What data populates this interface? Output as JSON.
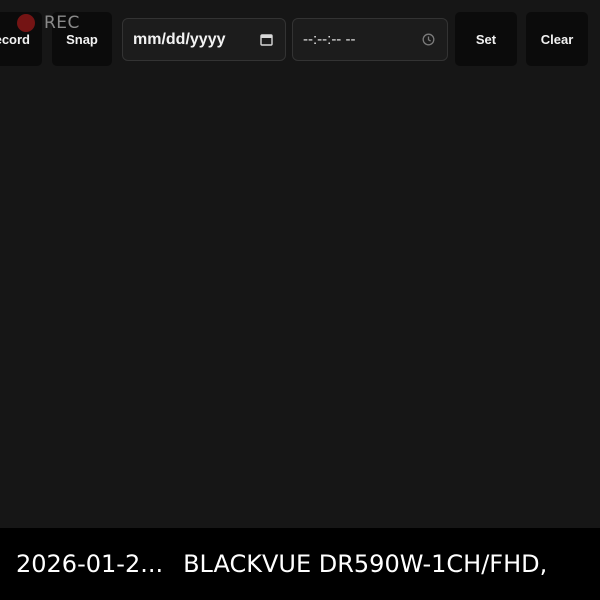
{
  "toolbar": {
    "record_label": "Record",
    "snap_label": "Snap",
    "set_label": "Set",
    "clear_label": "Clear"
  },
  "date_input": {
    "placeholder": "mm/dd/yyyy",
    "icon": "calendar-icon"
  },
  "time_input": {
    "placeholder": "--:--:-- --",
    "icon": "clock-icon"
  },
  "recording": {
    "label": "REC",
    "dot_color": "#7a1515"
  },
  "status_bar": {
    "timestamp": "2026-01-2...",
    "device": "BLACKVUE DR590W-1CH/FHD,"
  }
}
